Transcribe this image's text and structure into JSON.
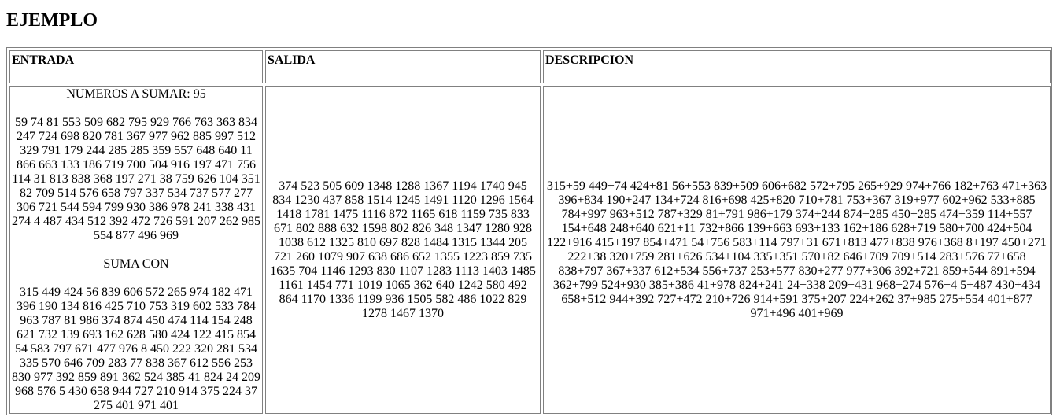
{
  "page": {
    "title": "EJEMPLO"
  },
  "table": {
    "headers": {
      "entrada": "ENTRADA",
      "salida": "SALIDA",
      "descripcion": "DESCRIPCION"
    },
    "entrada": {
      "label_numbers": "NUMEROS A SUMAR: 95",
      "numbers": "59 74 81 553 509 682 795 929 766 763 363 834 247 724 698 820 781 367 977 962 885 997 512 329 791 179 244 285 285 359 557 648 640 11 866 663 133 186 719 700 504 916 197 471 756 114 31 813 838 368 197 271 38 759 626 104 351 82 709 514 576 658 797 337 534 737 577 277 306 721 544 594 799 930 386 978 241 338 431 274 4 487 434 512 392 472 726 591 207 262 985 554 877 496 969",
      "label_suma": "SUMA CON",
      "suma": "315 449 424 56 839 606 572 265 974 182 471 396 190 134 816 425 710 753 319 602 533 784 963 787 81 986 374 874 450 474 114 154 248 621 732 139 693 162 628 580 424 122 415 854 54 583 797 671 477 976 8 450 222 320 281 534 335 570 646 709 283 77 838 367 612 556 253 830 977 392 859 891 362 524 385 41 824 24 209 968 576 5 430 658 944 727 210 914 375 224 37 275 401 971 401"
    },
    "salida": "374 523 505 609 1348 1288 1367 1194 1740 945 834 1230 437 858 1514 1245 1491 1120 1296 1564 1418 1781 1475 1116 872 1165 618 1159 735 833 671 802 888 632 1598 802 826 348 1347 1280 928 1038 612 1325 810 697 828 1484 1315 1344 205 721 260 1079 907 638 686 652 1355 1223 859 735 1635 704 1146 1293 830 1107 1283 1113 1403 1485 1161 1454 771 1019 1065 362 640 1242 580 492 864 1170 1336 1199 936 1505 582 486 1022 829 1278 1467 1370",
    "descripcion": "315+59 449+74 424+81 56+553 839+509 606+682 572+795 265+929 974+766 182+763 471+363 396+834 190+247 134+724 816+698 425+820 710+781 753+367 319+977 602+962 533+885 784+997 963+512 787+329 81+791 986+179 374+244 874+285 450+285 474+359 114+557 154+648 248+640 621+11 732+866 139+663 693+133 162+186 628+719 580+700 424+504 122+916 415+197 854+471 54+756 583+114 797+31 671+813 477+838 976+368 8+197 450+271 222+38 320+759 281+626 534+104 335+351 570+82 646+709 709+514 283+576 77+658 838+797 367+337 612+534 556+737 253+577 830+277 977+306 392+721 859+544 891+594 362+799 524+930 385+386 41+978 824+241 24+338 209+431 968+274 576+4 5+487 430+434 658+512 944+392 727+472 210+726 914+591 375+207 224+262 37+985 275+554 401+877 971+496 401+969"
  }
}
